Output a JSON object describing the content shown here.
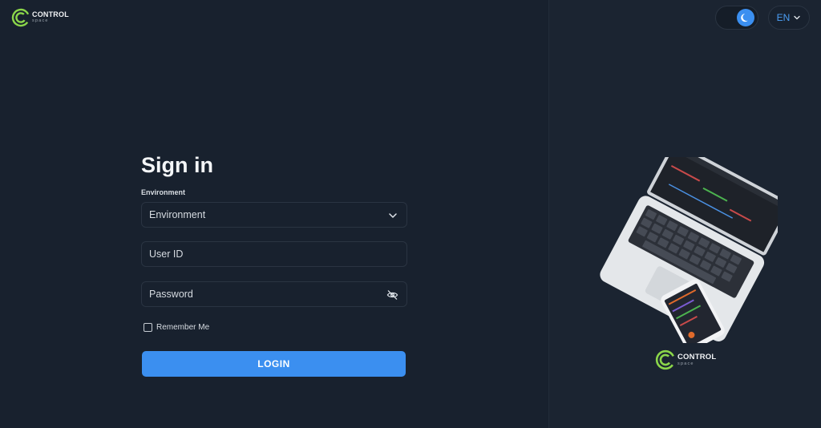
{
  "brand": {
    "name": "CONTROL",
    "subname": "space",
    "accent": "#8bd64a"
  },
  "header": {
    "language": "EN"
  },
  "form": {
    "title": "Sign in",
    "environment_label": "Environment",
    "environment_value": "Environment",
    "user_id_placeholder": "User ID",
    "password_placeholder": "Password",
    "remember_label": "Remember Me",
    "login_label": "LOGIN"
  },
  "colors": {
    "primary": "#3b8ff0",
    "background": "#18212e"
  },
  "icons": [
    "moon-icon",
    "chevron-down-icon",
    "eye-off-icon"
  ]
}
